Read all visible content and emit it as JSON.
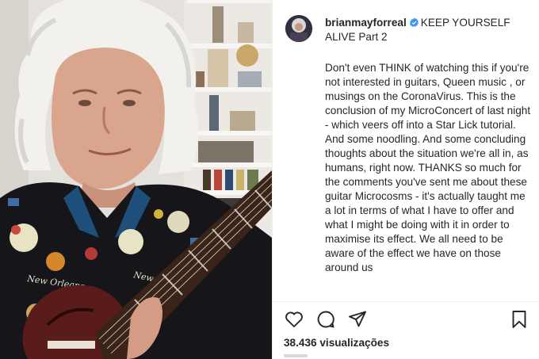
{
  "post": {
    "username": "brianmayforreal",
    "title": "KEEP YOURSELF ALIVE Part 2",
    "body": "Don't even THINK of watching this if you're not interested in guitars, Queen music , or musings on the CoronaVirus. This is the conclusion of my MicroConcert of last night - which veers off into a Star Lick tutorial. And some noodling. And some concluding thoughts about the situation we're all in, as humans, right now. THANKS so much for the comments you've sent me about these guitar Microcosms - it's actually taught me a lot in terms of what I have to offer and what I might be doing with it in order to maximise its effect. We all need to be aware of the effect we have on those around us"
  },
  "stats": {
    "views_count": "38.436",
    "views_label": "visualizações"
  },
  "media": {
    "shirt_text_1": "New Orleans",
    "shirt_text_2": "New Orleans"
  },
  "icons": {
    "verified": "verified-badge-icon",
    "like": "heart-icon",
    "comment": "comment-bubble-icon",
    "share": "paper-plane-icon",
    "save": "bookmark-icon"
  },
  "colors": {
    "verified_blue": "#3897f0",
    "text": "#262626"
  }
}
